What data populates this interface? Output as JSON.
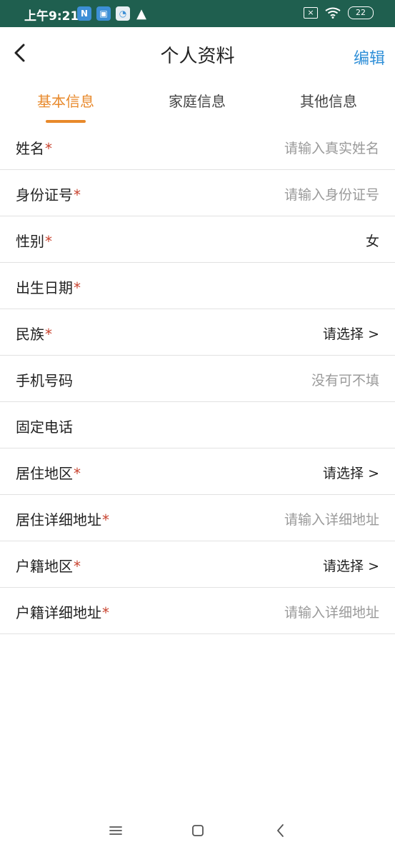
{
  "status_bar": {
    "time": "上午9:21",
    "notifications": [
      "N",
      "▣",
      "◔",
      "▲"
    ],
    "battery": "22"
  },
  "header": {
    "title": "个人资料",
    "edit_label": "编辑"
  },
  "tabs": [
    {
      "label": "基本信息",
      "active": true
    },
    {
      "label": "家庭信息",
      "active": false
    },
    {
      "label": "其他信息",
      "active": false
    }
  ],
  "form": {
    "required_mark": "*",
    "fields": [
      {
        "label": "姓名",
        "required": true,
        "value": "请输入真实姓名",
        "kind": "placeholder"
      },
      {
        "label": "身份证号",
        "required": true,
        "value": "请输入身份证号",
        "kind": "placeholder"
      },
      {
        "label": "性别",
        "required": true,
        "value": "女",
        "kind": "value"
      },
      {
        "label": "出生日期",
        "required": true,
        "value": "",
        "kind": "value"
      },
      {
        "label": "民族",
        "required": true,
        "value": "请选择 >",
        "kind": "value"
      },
      {
        "label": "手机号码",
        "required": false,
        "value": "没有可不填",
        "kind": "placeholder"
      },
      {
        "label": "固定电话",
        "required": false,
        "value": "",
        "kind": "value"
      },
      {
        "label": "居住地区",
        "required": true,
        "value": "请选择 >",
        "kind": "value"
      },
      {
        "label": "居住详细地址",
        "required": true,
        "value": "请输入详细地址",
        "kind": "placeholder"
      },
      {
        "label": "户籍地区",
        "required": true,
        "value": "请选择 >",
        "kind": "value"
      },
      {
        "label": "户籍详细地址",
        "required": true,
        "value": "请输入详细地址",
        "kind": "placeholder"
      }
    ]
  },
  "colors": {
    "status_bar": "#1f5f4f",
    "accent": "#e8892b",
    "edit": "#2f8fd8",
    "required": "#c8432f",
    "placeholder": "#9a9a9a"
  },
  "icons": {
    "back": "back-arrow-icon",
    "menu": "menu-icon",
    "home": "home-icon",
    "nav_back": "nav-back-icon"
  }
}
